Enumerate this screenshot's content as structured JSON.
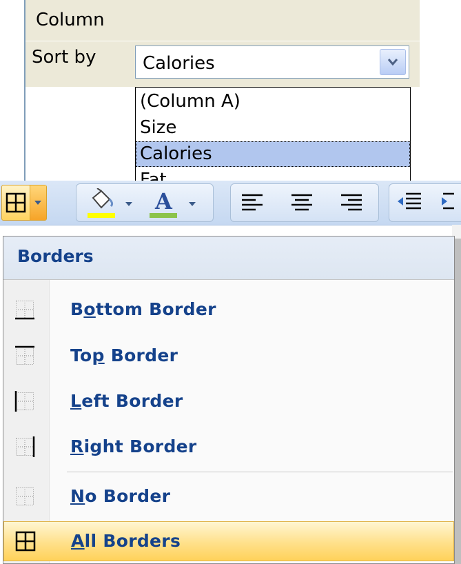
{
  "sort_dialog": {
    "column_header": "Column",
    "sort_by_label": "Sort by",
    "selected_value": "Calories",
    "options": [
      "(Column A)",
      "Size",
      "Calories",
      "Fat"
    ],
    "selected_index": 2
  },
  "toolbar": {
    "borders_icon": "all-borders-icon",
    "fill_color_icon": "paint-bucket-icon",
    "fill_color": "#ffff00",
    "font_color_icon": "font-color-icon",
    "font_color": "#8bc34a",
    "align_icons": [
      "align-left-icon",
      "align-center-icon",
      "align-right-icon"
    ],
    "indent_icons": [
      "decrease-indent-icon",
      "increase-indent-icon"
    ]
  },
  "borders_menu": {
    "title": "Borders",
    "items": [
      {
        "pre": "B",
        "key": "o",
        "post": "ttom Border",
        "icon": "bottom-border-icon"
      },
      {
        "pre": "To",
        "key": "p",
        "post": " Border",
        "icon": "top-border-icon"
      },
      {
        "pre": "",
        "key": "L",
        "post": "eft Border",
        "icon": "left-border-icon"
      },
      {
        "pre": "",
        "key": "R",
        "post": "ight Border",
        "icon": "right-border-icon"
      },
      {
        "pre": "",
        "key": "N",
        "post": "o Border",
        "icon": "no-border-icon"
      },
      {
        "pre": "",
        "key": "A",
        "post": "ll Borders",
        "icon": "all-borders-icon",
        "highlighted": true
      }
    ]
  }
}
